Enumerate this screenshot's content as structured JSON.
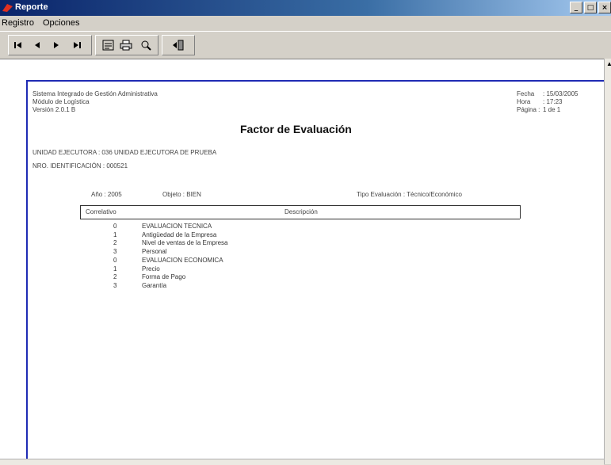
{
  "window": {
    "title": "Reporte",
    "minimize": "_",
    "maximize": "□",
    "close": "×"
  },
  "menu": [
    "Registro",
    "Opciones"
  ],
  "toolbar": {
    "buttons": [
      {
        "name": "first-page-icon",
        "glyph": "|◀"
      },
      {
        "name": "prev-page-icon",
        "glyph": "◀"
      },
      {
        "name": "next-page-icon",
        "glyph": "▶"
      },
      {
        "name": "last-page-icon",
        "glyph": "▶|"
      },
      {
        "name": "export-icon",
        "glyph": "▤"
      },
      {
        "name": "printer-icon",
        "glyph": "⎙"
      },
      {
        "name": "zoom-icon",
        "glyph": "⌕"
      },
      {
        "name": "exit-icon",
        "glyph": "⇥"
      }
    ]
  },
  "report": {
    "system_line1": "Sistema Integrado de Gestión Administrativa",
    "system_line2": "Módulo de Logística",
    "system_line3": "Versión 2.0.1 B",
    "fecha_label": "Fecha",
    "fecha_value": ": 15/03/2005",
    "hora_label": "Hora",
    "hora_value": ": 17:23",
    "pagina_label": "Página :",
    "pagina_value": "1 de 1",
    "title": "Factor de Evaluación",
    "unidad": "UNIDAD EJECUTORA   : 036   UNIDAD EJECUTORA DE PRUEBA",
    "nro": "NRO. IDENTIFICACIÓN : 000521",
    "anio": "Año : 2005",
    "objeto": "Objeto : BIEN",
    "tipo_eval": "Tipo Evaluación : Técnico/Económico",
    "col_correlativo": "Correlativo",
    "col_descripcion": "Descripción",
    "rows": [
      {
        "num": "0",
        "desc": "EVALUACION TECNICA"
      },
      {
        "num": "1",
        "desc": "Antigüedad de la Empresa"
      },
      {
        "num": "2",
        "desc": "Nivel de ventas de la Empresa"
      },
      {
        "num": "3",
        "desc": "Personal"
      },
      {
        "num": "0",
        "desc": "EVALUACION ECONOMICA"
      },
      {
        "num": "1",
        "desc": "Precio"
      },
      {
        "num": "2",
        "desc": "Forma de Pago"
      },
      {
        "num": "3",
        "desc": "Garantía"
      }
    ]
  }
}
